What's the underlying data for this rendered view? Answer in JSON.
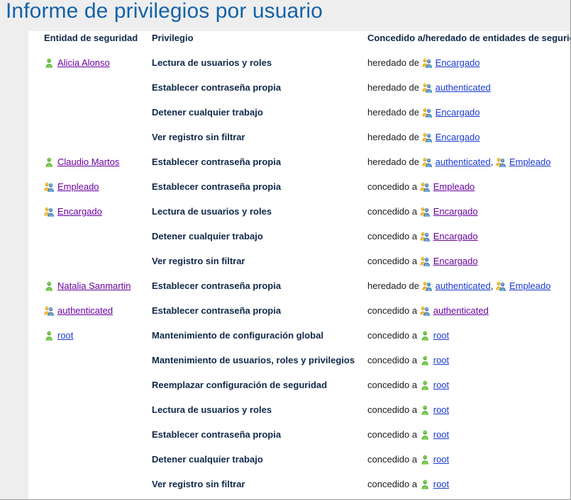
{
  "window": {
    "title": "Informe de privilegios por usuario"
  },
  "table": {
    "headers": {
      "entity": "Entidad de seguridad",
      "privilege": "Privilegio",
      "granted": "Concedido a/heredado de entidades de seguridad"
    },
    "rows": [
      {
        "entity": {
          "label": "Alicia Alonso",
          "icon": "user-icon",
          "link_state": "visited"
        },
        "privilege": "Lectura de usuarios y roles",
        "relation": "heredado de",
        "principals": [
          {
            "label": "Encargado",
            "icon": "group-icon",
            "link_state": "unvisited"
          }
        ]
      },
      {
        "entity": null,
        "privilege": "Establecer contraseña propia",
        "relation": "heredado de",
        "principals": [
          {
            "label": "authenticated",
            "icon": "group-icon",
            "link_state": "unvisited"
          }
        ]
      },
      {
        "entity": null,
        "privilege": "Detener cualquier trabajo",
        "relation": "heredado de",
        "principals": [
          {
            "label": "Encargado",
            "icon": "group-icon",
            "link_state": "unvisited"
          }
        ]
      },
      {
        "entity": null,
        "privilege": "Ver registro sin filtrar",
        "relation": "heredado de",
        "principals": [
          {
            "label": "Encargado",
            "icon": "group-icon",
            "link_state": "unvisited"
          }
        ]
      },
      {
        "entity": {
          "label": "Claudio Martos",
          "icon": "user-icon",
          "link_state": "visited"
        },
        "privilege": "Establecer contraseña propia",
        "relation": "heredado de",
        "principals": [
          {
            "label": "authenticated",
            "icon": "group-icon",
            "link_state": "unvisited"
          },
          {
            "label": "Empleado",
            "icon": "group-icon",
            "link_state": "unvisited"
          }
        ]
      },
      {
        "entity": {
          "label": "Empleado",
          "icon": "group-icon",
          "link_state": "visited"
        },
        "privilege": "Establecer contraseña propia",
        "relation": "concedido a",
        "principals": [
          {
            "label": "Empleado",
            "icon": "group-icon",
            "link_state": "visited"
          }
        ]
      },
      {
        "entity": {
          "label": "Encargado",
          "icon": "group-icon",
          "link_state": "visited"
        },
        "privilege": "Lectura de usuarios y roles",
        "relation": "concedido a",
        "principals": [
          {
            "label": "Encargado",
            "icon": "group-icon",
            "link_state": "visited"
          }
        ]
      },
      {
        "entity": null,
        "privilege": "Detener cualquier trabajo",
        "relation": "concedido a",
        "principals": [
          {
            "label": "Encargado",
            "icon": "group-icon",
            "link_state": "visited"
          }
        ]
      },
      {
        "entity": null,
        "privilege": "Ver registro sin filtrar",
        "relation": "concedido a",
        "principals": [
          {
            "label": "Encargado",
            "icon": "group-icon",
            "link_state": "visited"
          }
        ]
      },
      {
        "entity": {
          "label": "Natalia Sanmartin",
          "icon": "user-icon",
          "link_state": "visited"
        },
        "privilege": "Establecer contraseña propia",
        "relation": "heredado de",
        "principals": [
          {
            "label": "authenticated",
            "icon": "group-icon",
            "link_state": "unvisited"
          },
          {
            "label": "Empleado",
            "icon": "group-icon",
            "link_state": "unvisited"
          }
        ]
      },
      {
        "entity": {
          "label": "authenticated",
          "icon": "group-icon",
          "link_state": "visited"
        },
        "privilege": "Establecer contraseña propia",
        "relation": "concedido a",
        "principals": [
          {
            "label": "authenticated",
            "icon": "group-icon",
            "link_state": "visited"
          }
        ]
      },
      {
        "entity": {
          "label": "root",
          "icon": "user-icon",
          "link_state": "unvisited"
        },
        "privilege": "Mantenimiento de configuración global",
        "relation": "concedido a",
        "principals": [
          {
            "label": "root",
            "icon": "user-icon",
            "link_state": "unvisited"
          }
        ]
      },
      {
        "entity": null,
        "privilege": "Mantenimiento de usuarios, roles y privilegios",
        "relation": "concedido a",
        "principals": [
          {
            "label": "root",
            "icon": "user-icon",
            "link_state": "unvisited"
          }
        ]
      },
      {
        "entity": null,
        "privilege": "Reemplazar configuración de seguridad",
        "relation": "concedido a",
        "principals": [
          {
            "label": "root",
            "icon": "user-icon",
            "link_state": "unvisited"
          }
        ]
      },
      {
        "entity": null,
        "privilege": "Lectura de usuarios y roles",
        "relation": "concedido a",
        "principals": [
          {
            "label": "root",
            "icon": "user-icon",
            "link_state": "unvisited"
          }
        ]
      },
      {
        "entity": null,
        "privilege": "Establecer contraseña propia",
        "relation": "concedido a",
        "principals": [
          {
            "label": "root",
            "icon": "user-icon",
            "link_state": "unvisited"
          }
        ]
      },
      {
        "entity": null,
        "privilege": "Detener cualquier trabajo",
        "relation": "concedido a",
        "principals": [
          {
            "label": "root",
            "icon": "user-icon",
            "link_state": "unvisited"
          }
        ]
      },
      {
        "entity": null,
        "privilege": "Ver registro sin filtrar",
        "relation": "concedido a",
        "principals": [
          {
            "label": "root",
            "icon": "user-icon",
            "link_state": "unvisited"
          }
        ]
      }
    ],
    "separator": ", "
  },
  "colors": {
    "title": "#1462a8",
    "header_text": "#10284a",
    "privilege_text": "#10284a",
    "link_visited": "#6a00a0",
    "link_unvisited": "#1a3ad0",
    "chrome_bg": "#eeeeee",
    "content_bg": "#ffffff"
  }
}
